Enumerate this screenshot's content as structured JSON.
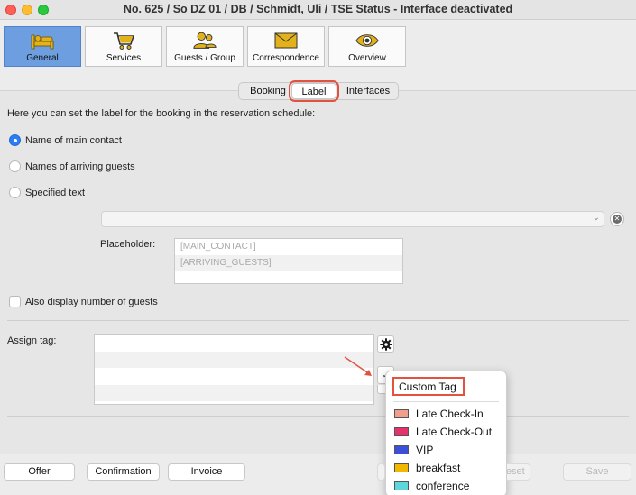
{
  "window": {
    "title": "No. 625 / So DZ 01 / DB / Schmidt, Uli / TSE Status - Interface deactivated"
  },
  "toolbar": {
    "items": [
      {
        "label": "General",
        "icon": "bed-icon"
      },
      {
        "label": "Services",
        "icon": "cart-icon"
      },
      {
        "label": "Guests / Group",
        "icon": "people-icon"
      },
      {
        "label": "Correspondence",
        "icon": "envelope-icon"
      },
      {
        "label": "Overview",
        "icon": "eye-icon"
      }
    ],
    "active_index": 0,
    "accent_color": "#6d9fe0",
    "icon_color": "#e3b21b"
  },
  "tabs": {
    "items": [
      "Booking",
      "Label",
      "Interfaces"
    ],
    "selected": "Label"
  },
  "label_section": {
    "description": "Here you can set the label for the booking in the reservation schedule:",
    "options": [
      {
        "label": "Name of main contact",
        "selected": true
      },
      {
        "label": "Names of arriving guests",
        "selected": false
      },
      {
        "label": "Specified text",
        "selected": false
      }
    ],
    "text_value": "",
    "placeholder_label": "Placeholder:",
    "placeholders": [
      "[MAIN_CONTACT]",
      "[ARRIVING_GUESTS]"
    ],
    "display_guests_label": "Also display number of guests",
    "display_guests_checked": false
  },
  "tag_section": {
    "label": "Assign tag:"
  },
  "tag_menu": {
    "title": "Custom Tag",
    "items": [
      {
        "label": "Late Check-In",
        "color": "#f0a08a"
      },
      {
        "label": "Late Check-Out",
        "color": "#e8306a"
      },
      {
        "label": "VIP",
        "color": "#3b4fd8"
      },
      {
        "label": "breakfast",
        "color": "#f2b800"
      },
      {
        "label": "conference",
        "color": "#5fd6dc"
      }
    ]
  },
  "footer": {
    "offer_label": "Offer",
    "confirmation_label": "Confirmation",
    "invoice_label": "Invoice",
    "reset_label": "Reset",
    "save_label": "Save"
  },
  "highlight_color": "#e2523e"
}
